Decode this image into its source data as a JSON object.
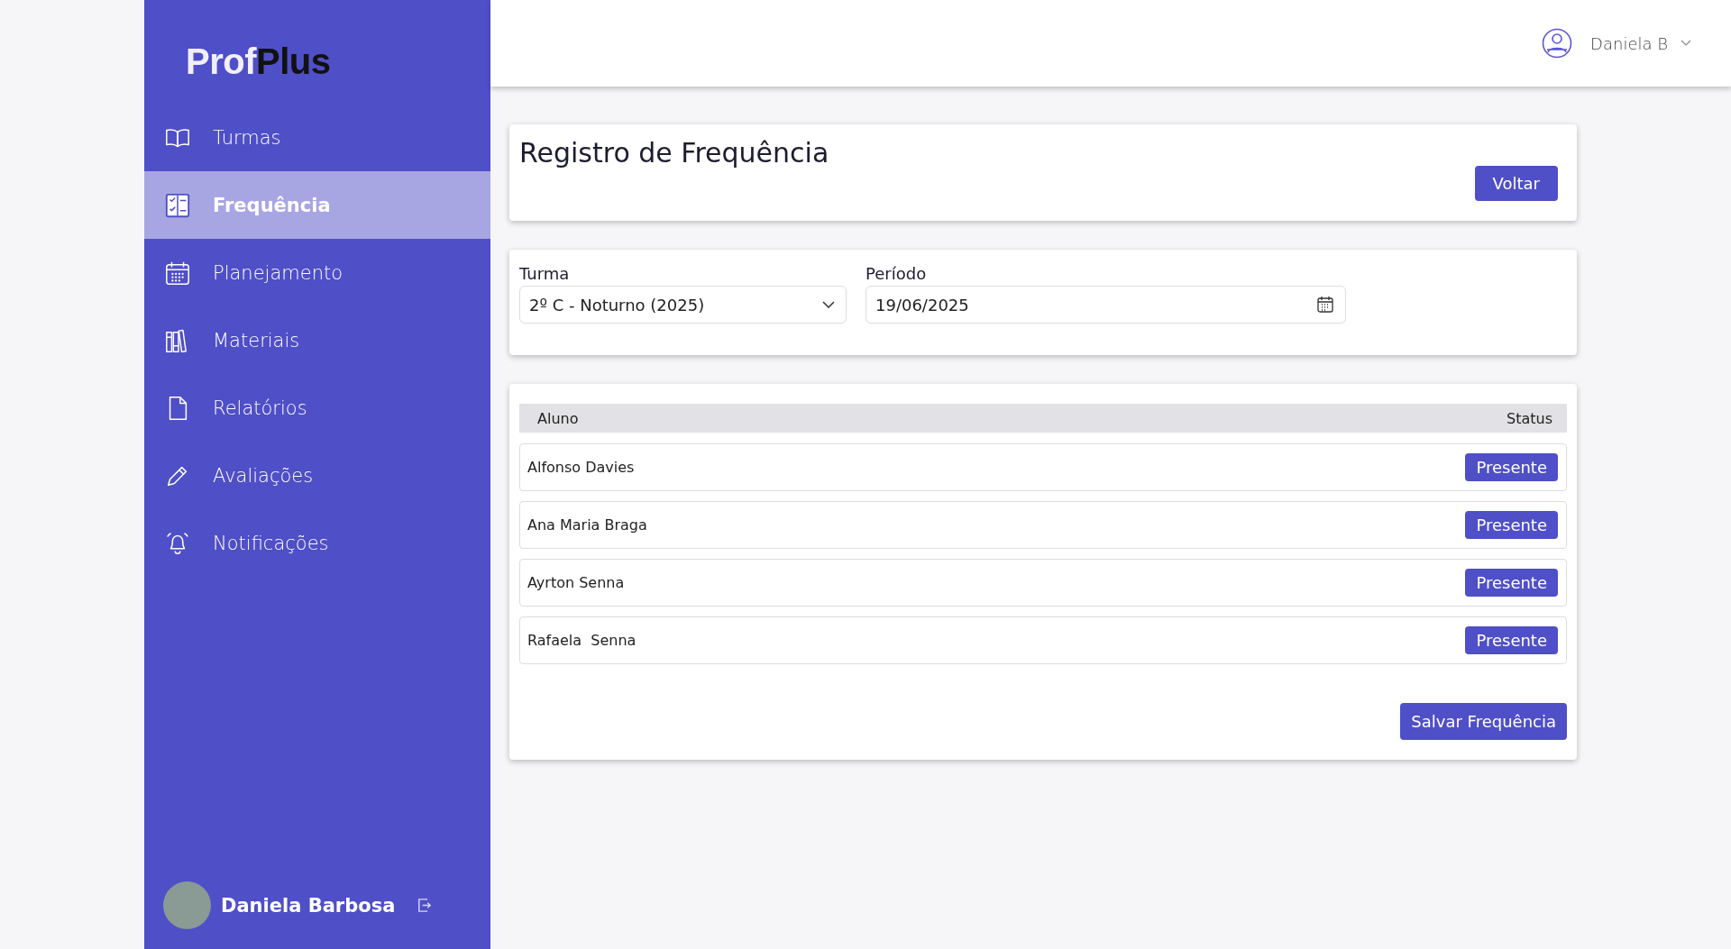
{
  "sidebar": {
    "logo": {
      "first": "Prof",
      "second": "Plus"
    },
    "items": [
      {
        "label": "Turmas",
        "kind": "book",
        "selected": false
      },
      {
        "label": "Frequência",
        "kind": "checklist",
        "selected": true
      },
      {
        "label": "Planejamento",
        "kind": "calendar",
        "selected": false
      },
      {
        "label": "Materiais",
        "kind": "books",
        "selected": false
      },
      {
        "label": "Relatórios",
        "kind": "document",
        "selected": false
      },
      {
        "label": "Avaliações",
        "kind": "pencil",
        "selected": false
      },
      {
        "label": "Notificações",
        "kind": "bell",
        "selected": false
      }
    ],
    "user": {
      "name": "Daniela Barbosa"
    }
  },
  "header": {
    "user_name": "Daniela B"
  },
  "page": {
    "title": "Registro de Frequência",
    "back_button": "Voltar"
  },
  "filters": {
    "turma": {
      "label": "Turma",
      "value": "2º C - Noturno (2025)"
    },
    "periodo": {
      "label": "Período",
      "value": "19/06/2025"
    }
  },
  "table": {
    "columns": [
      "Aluno",
      "Status"
    ],
    "rows": [
      {
        "student": "Alfonso Davies",
        "status": "Presente"
      },
      {
        "student": "Ana Maria Braga",
        "status": "Presente"
      },
      {
        "student": "Ayrton Senna",
        "status": "Presente"
      },
      {
        "student": "Rafaela  Senna",
        "status": "Presente"
      }
    ],
    "save_button": "Salvar Frequência"
  }
}
